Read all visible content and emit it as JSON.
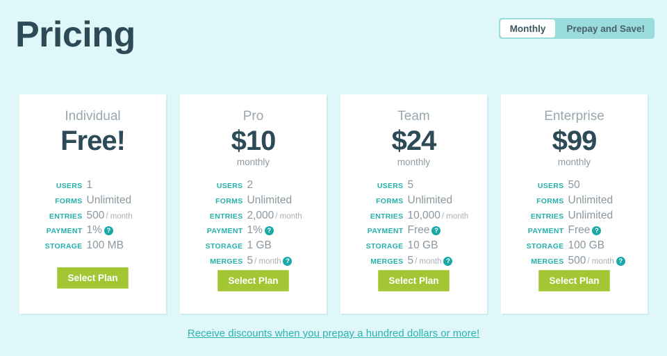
{
  "header": {
    "title": "Pricing",
    "billing_toggle": {
      "options": [
        {
          "label": "Monthly",
          "active": true
        },
        {
          "label": "Prepay and Save!",
          "active": false
        }
      ]
    }
  },
  "plans": [
    {
      "name": "Individual",
      "price": "Free!",
      "period": "",
      "cta": "Select Plan",
      "features": [
        {
          "label": "USERS",
          "value": "1",
          "suffix": "",
          "help": false
        },
        {
          "label": "FORMS",
          "value": "Unlimited",
          "suffix": "",
          "help": false
        },
        {
          "label": "ENTRIES",
          "value": "500",
          "suffix": "/ month",
          "help": false
        },
        {
          "label": "PAYMENT",
          "value": "1%",
          "suffix": "",
          "help": true
        },
        {
          "label": "STORAGE",
          "value": "100 MB",
          "suffix": "",
          "help": false
        }
      ]
    },
    {
      "name": "Pro",
      "price": "$10",
      "period": "monthly",
      "cta": "Select Plan",
      "features": [
        {
          "label": "USERS",
          "value": "2",
          "suffix": "",
          "help": false
        },
        {
          "label": "FORMS",
          "value": "Unlimited",
          "suffix": "",
          "help": false
        },
        {
          "label": "ENTRIES",
          "value": "2,000",
          "suffix": "/ month",
          "help": false
        },
        {
          "label": "PAYMENT",
          "value": "1%",
          "suffix": "",
          "help": true
        },
        {
          "label": "STORAGE",
          "value": "1 GB",
          "suffix": "",
          "help": false
        },
        {
          "label": "MERGES",
          "value": "5",
          "suffix": "/ month",
          "help": true
        }
      ]
    },
    {
      "name": "Team",
      "price": "$24",
      "period": "monthly",
      "cta": "Select Plan",
      "features": [
        {
          "label": "USERS",
          "value": "5",
          "suffix": "",
          "help": false
        },
        {
          "label": "FORMS",
          "value": "Unlimited",
          "suffix": "",
          "help": false
        },
        {
          "label": "ENTRIES",
          "value": "10,000",
          "suffix": "/ month",
          "help": false
        },
        {
          "label": "PAYMENT",
          "value": "Free",
          "suffix": "",
          "help": true
        },
        {
          "label": "STORAGE",
          "value": "10 GB",
          "suffix": "",
          "help": false
        },
        {
          "label": "MERGES",
          "value": "5",
          "suffix": "/ month",
          "help": true
        }
      ]
    },
    {
      "name": "Enterprise",
      "price": "$99",
      "period": "monthly",
      "cta": "Select Plan",
      "features": [
        {
          "label": "USERS",
          "value": "50",
          "suffix": "",
          "help": false
        },
        {
          "label": "FORMS",
          "value": "Unlimited",
          "suffix": "",
          "help": false
        },
        {
          "label": "ENTRIES",
          "value": "Unlimited",
          "suffix": "",
          "help": false
        },
        {
          "label": "PAYMENT",
          "value": "Free",
          "suffix": "",
          "help": true
        },
        {
          "label": "STORAGE",
          "value": "100 GB",
          "suffix": "",
          "help": false
        },
        {
          "label": "MERGES",
          "value": "500",
          "suffix": "/ month",
          "help": true
        }
      ]
    }
  ],
  "footer": {
    "link_text": "Receive discounts when you prepay a hundred dollars or more!"
  },
  "icons": {
    "help": "?"
  },
  "colors": {
    "page_background": "#e0f7f9",
    "card_background": "#ffffff",
    "title": "#2d4a57",
    "accent_teal": "#25b0ac",
    "cta_green": "#a2c634",
    "toggle_track": "#9adcdc",
    "value_gray": "#8b979e",
    "plan_name_gray": "#9aa7ad"
  }
}
